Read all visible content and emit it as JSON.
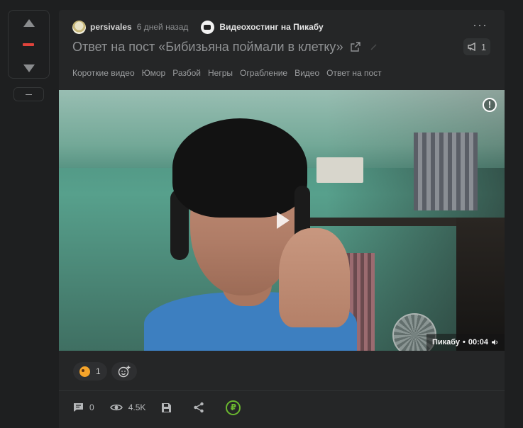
{
  "post": {
    "author": "persivales",
    "time_ago": "6 дней назад",
    "community": "Видеохостинг на Пикабу",
    "title": "Ответ на пост «Бибизьяна поймали в клетку»",
    "repost_count": "1",
    "more_label": "···",
    "tags": [
      "Короткие видео",
      "Юмор",
      "Разбой",
      "Негры",
      "Ограбление",
      "Видео",
      "Ответ на пост"
    ]
  },
  "rating": {
    "collapse_label": ""
  },
  "video": {
    "source": "Пикабу",
    "separator": "•",
    "duration": "00:04",
    "report_label": "!"
  },
  "reactions": {
    "count": "1"
  },
  "footer": {
    "comments": "0",
    "views": "4.5K",
    "donate_label": "₽"
  },
  "colors": {
    "background": "#1e1f20",
    "card": "#252627",
    "score_accent": "#e0433b",
    "donate_green": "#6bb82f"
  }
}
